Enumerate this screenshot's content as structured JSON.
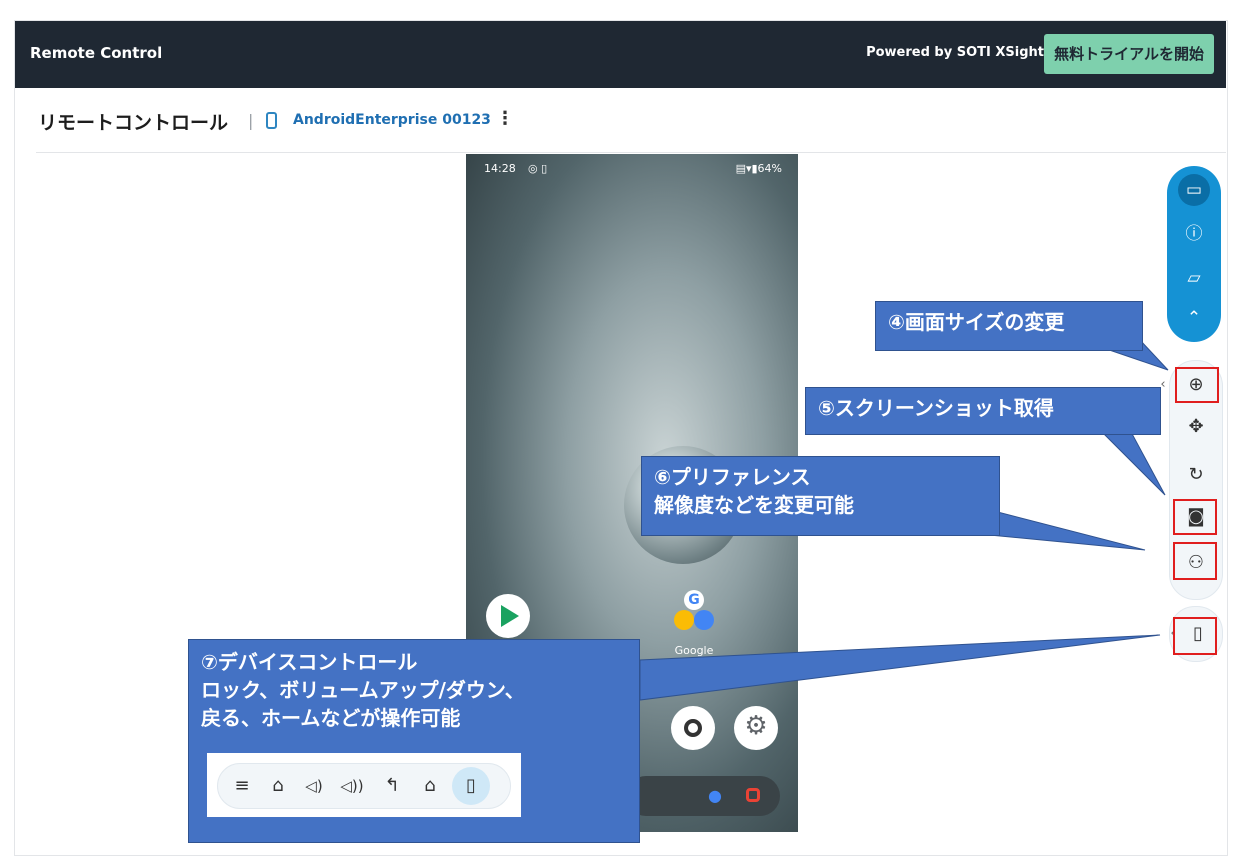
{
  "topbar": {
    "title": "Remote Control",
    "powered_by": "Powered by SOTI XSight",
    "trial_button": "無料トライアルを開始"
  },
  "header": {
    "page_title": "リモートコントロール",
    "separator": "|",
    "device_name": "AndroidEnterprise 00123",
    "kebab": "⋮"
  },
  "phone": {
    "status_time": "14:28",
    "status_left_icons": "◎ ▯",
    "status_right": "▤▾▮64%",
    "google_label": "Google",
    "google_letter": "G"
  },
  "callouts": {
    "c4": "④画面サイズの変更",
    "c5": "⑤スクリーンショット取得",
    "c6_line1": "⑥プリファレンス",
    "c6_line2": "解像度などを変更可能",
    "c7_line1": "⑦デバイスコントロール",
    "c7_line2": "ロック、ボリュームアップ/ダウン、",
    "c7_line3": "戻る、ホームなどが操作可能"
  },
  "toolbar_icons": {
    "cast": "▭",
    "info": "ⓘ",
    "folder": "▱",
    "collapse": "⌃",
    "zoom": "⊕",
    "move": "✥",
    "rotate": "↻",
    "screenshot": "◙",
    "preferences": "⚇",
    "device": "▯",
    "collapse_left": "‹"
  },
  "inset_icons": {
    "menu": "≡",
    "lock": "⌂",
    "vol_down": "◁)",
    "vol_up": "◁))",
    "back": "↰",
    "home": "⌂",
    "device": "▯"
  },
  "colors": {
    "topbar": "#1f2833",
    "trial": "#7ed0ad",
    "accent": "#1592d4",
    "callout": "#4472c4",
    "highlight": "#e01e1e"
  }
}
